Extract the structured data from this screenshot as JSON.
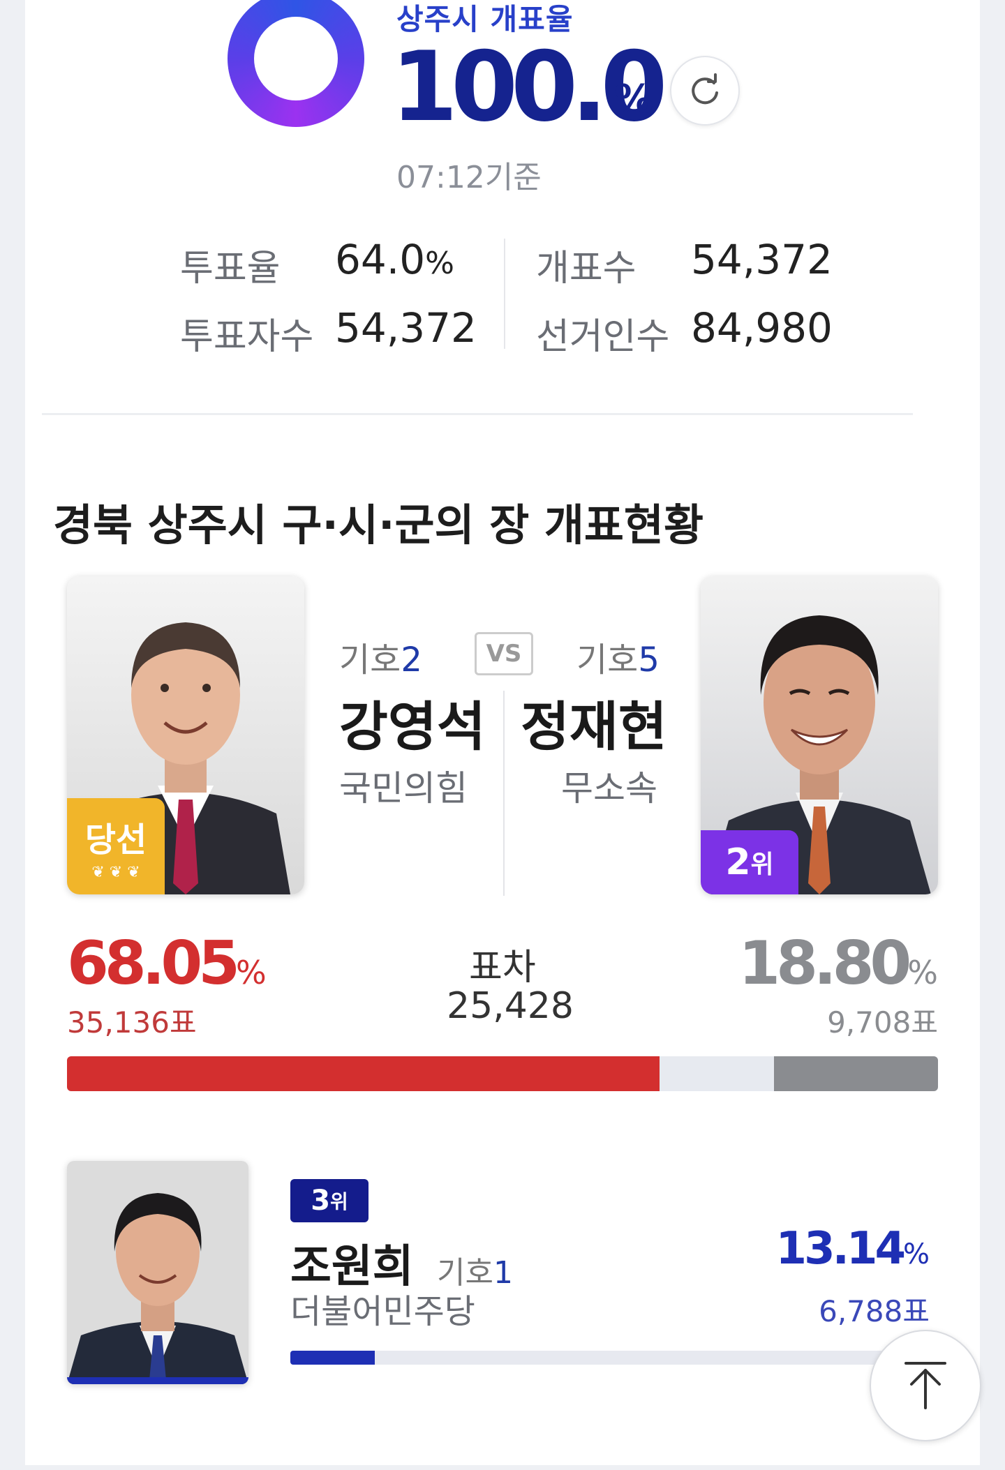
{
  "header": {
    "title": "상주시 개표율",
    "rate_value": "100.0",
    "rate_unit": "%",
    "timestamp": "07:12기준"
  },
  "stats": {
    "turnout_label": "투표율",
    "turnout_value": "64.0",
    "turnout_unit": "%",
    "voters_label": "투표자수",
    "voters_value": "54,372",
    "counted_label": "개표수",
    "counted_value": "54,372",
    "electorate_label": "선거인수",
    "electorate_value": "84,980"
  },
  "section_title": "경북 상주시 구·시·군의 장 개표현황",
  "candidates": [
    {
      "number_prefix": "기호",
      "number": "2",
      "name": "강영석",
      "party": "국민의힘",
      "badge": "당선",
      "pct": "68.05",
      "pct_unit": "%",
      "votes": "35,136표",
      "color": "#d32f2f",
      "share": 0.6805
    },
    {
      "number_prefix": "기호",
      "number": "5",
      "name": "정재현",
      "party": "무소속",
      "badge_rank": "2",
      "badge_suffix": "위",
      "pct": "18.80",
      "pct_unit": "%",
      "votes": "9,708표",
      "color": "#8a8c90",
      "share": 0.188
    },
    {
      "number_prefix": "기호",
      "number": "1",
      "name": "조원희",
      "party": "더불어민주당",
      "badge_rank": "3",
      "badge_suffix": "위",
      "pct": "13.14",
      "pct_unit": "%",
      "votes": "6,788표",
      "color": "#1e2fb4",
      "share": 0.1314
    }
  ],
  "vs_label": "VS",
  "gap": {
    "label": "표차",
    "value": "25,428"
  },
  "icons": {
    "refresh": "refresh-icon",
    "scroll_top": "arrow-up-to-top-icon"
  },
  "colors": {
    "accent_navy": "#15238f",
    "winner_red": "#d32f2f",
    "second_purple": "#7c32e6",
    "third_navy": "#141c8c",
    "gold": "#f1b52a"
  }
}
